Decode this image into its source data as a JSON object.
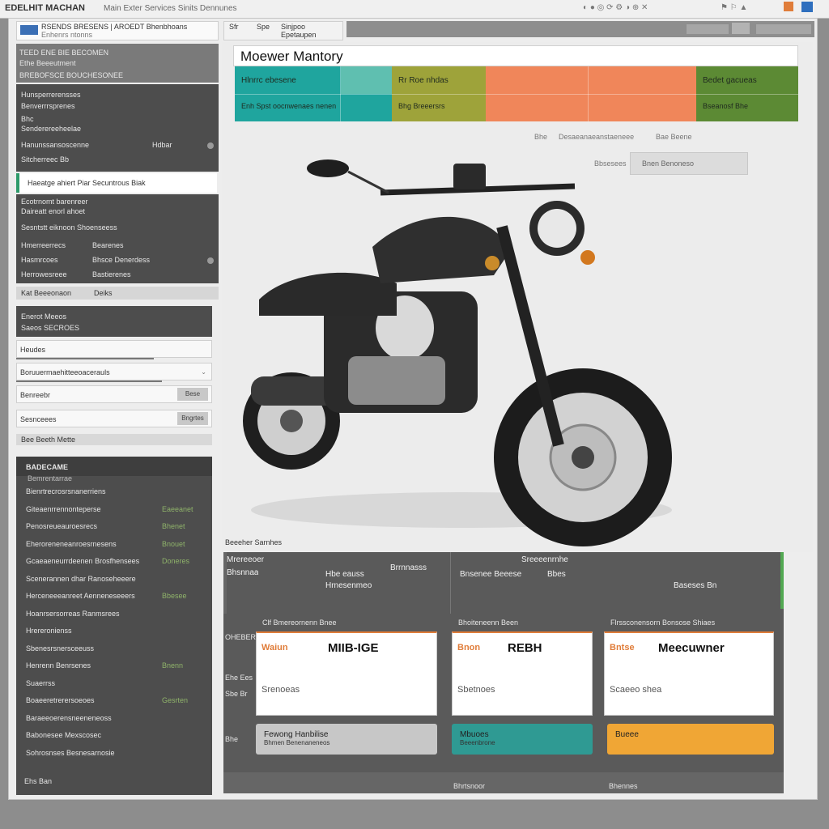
{
  "window": {
    "title": "EDELHIT MACHAN",
    "title_menu": "Main Exter Services Sinits Dennunes",
    "toolbar_tab_1": "Sfr",
    "toolbar_tab_2": "Spe",
    "toolbar_tab_3": "Sinjpoo",
    "toolbar_tab_4": "Epetaupen",
    "address": "RSENDS BRESENS | AROEDT Bhenbhoans",
    "address_2": "Enhenrs ntonns"
  },
  "sidebar": {
    "header_title": "TEED ENE BIE BECOMEN",
    "header_sub": "Ethe Beeeutment",
    "header_line2": "BREBOFSCE BOUCHESONEE",
    "group1": [
      {
        "label": "Hunsperrerensses",
        "value": ""
      },
      {
        "label": "Benverrrsprenes",
        "value": ""
      },
      {
        "label": "Bhc",
        "value": ""
      },
      {
        "label": "Senderereeheelae",
        "value": ""
      },
      {
        "label": "Hanunssansoscenne",
        "value": "Hdbar"
      },
      {
        "label": "Sitcherreec Bb",
        "value": ""
      }
    ],
    "selected_item": "Haeatge ahiert Piar Secuntrous Biak",
    "group2": [
      {
        "label": "Ecotrnomt barenreer",
        "value": ""
      },
      {
        "label": "Daireatt enorl ahoet",
        "value": ""
      },
      {
        "label": "Sesntstt eiknoon Shoenseess",
        "value": ""
      },
      {
        "label": "Hmerreerrecs",
        "value": "Bearenes"
      },
      {
        "label": "Hasmrcoes",
        "value": "Bhsce Denerdess"
      },
      {
        "label": "Herrowesreee",
        "value": "Bastierenes"
      }
    ],
    "divider_label": "Kat Beeeonaon",
    "divider_val": "Deiks",
    "form_title": "Enerot Meeos",
    "form_sub": "Saeos SECROES",
    "fields": [
      {
        "label": "Heudes",
        "button": ""
      },
      {
        "label": "Boruuermaehitteeoacerauls",
        "button": ""
      },
      {
        "label": "Benreebr",
        "button": "Bese"
      },
      {
        "label": "Sesnceees",
        "button": "Bngrtes"
      }
    ],
    "tiny_row": "Bee Beeth Mette",
    "list_title": "BADECAME",
    "list_subtitle": "Bemrentarrae",
    "list": [
      {
        "label": "Bienrtrecrosrsnanerriens",
        "value": ""
      },
      {
        "label": "Giteaenrrennonteperse",
        "value": "Eaeeanet"
      },
      {
        "label": "Penosreueauroesrecs",
        "value": "Bhenet"
      },
      {
        "label": "Eheroreneneanroesrnesens",
        "value": "Bnouet"
      },
      {
        "label": "Gcaeaeneurrdeenen Brosfhensees",
        "value": "Doneres"
      },
      {
        "label": "Scenerannen dhar Ranoseheeere",
        "value": ""
      },
      {
        "label": "Herceneeeanreet Aenneneseeers",
        "value": "Bbesee"
      },
      {
        "label": "Hoanrsersorreas Ranmsrees",
        "value": ""
      },
      {
        "label": "Hrereronienss",
        "value": ""
      },
      {
        "label": "Sbenesrsnersceeuss",
        "value": ""
      },
      {
        "label": "Henrenn Benrsenes",
        "value": "Bnenn"
      },
      {
        "label": "Suaerrss",
        "value": ""
      },
      {
        "label": "Boaeeretrerersoeoes",
        "value": "Gesrten"
      },
      {
        "label": "Baraeeoerensneeneneoss",
        "value": ""
      },
      {
        "label": "Babonesee Mexscosec",
        "value": ""
      },
      {
        "label": "Sohrosnses Besnesarnosie",
        "value": ""
      }
    ],
    "footer": "Ehs Ban"
  },
  "main": {
    "title": "Moewer Mantory",
    "color_bars": [
      {
        "top": "Hlnrrc ebesene",
        "bottom": "Enh Spst oocnwenaes nenen",
        "color": "#1fa59e"
      },
      {
        "top": "Rr Roe nhdas",
        "bottom": "Bhg Breeersrs",
        "color": "#9ea33a"
      },
      {
        "top": "",
        "bottom": "",
        "color": "#f0865a"
      },
      {
        "top": "Bedet gacueas",
        "bottom": "Bseanosf Bhe",
        "color": "#5c8a34"
      }
    ],
    "filter_label": "Bhe",
    "filter_value": "Desaeanaeanstaeneee",
    "filter_right": "Bae Beene",
    "search_label": "Bbsesees",
    "search_value": "Bnen Benoneso",
    "image_caption": "Beeeher Sarnhes",
    "spec_header": [
      {
        "label": "Mrereeoer",
        "value": "Bhsnnaa"
      },
      {
        "label": "Hbe eauss",
        "value": "Hrnesenmeo"
      },
      {
        "label": "Brrnnasss",
        "value": "Bnsenee Beeese"
      },
      {
        "label": "Sreeeenrnhe",
        "value": "Bbes"
      }
    ],
    "spec_extra": "Baseses Bn",
    "cards_section": [
      {
        "heading": "Clf Bmereornenn Bnee",
        "label": "Waiun",
        "value": "MIIB-IGE",
        "sub": "Srenoeas",
        "label_color": "#e07d3a",
        "pill_text": "Fewong Hanbilise",
        "pill_sub": "Bhmen Benenaneneos",
        "pill_color": "#c7c7c7"
      },
      {
        "heading": "Bhoiteneenn Been",
        "label": "Bnon",
        "value": "REBH",
        "sub": "Sbetnoes",
        "label_color": "#e07d3a",
        "pill_text": "Mbuoes",
        "pill_sub": "Beeenbrone",
        "pill_color": "#2f9a93"
      },
      {
        "heading": "Flrssconensorn Bonsose Shiaes",
        "label": "Bntse",
        "value": "Meecuwner",
        "sub": "Scaeeo shea",
        "label_color": "#e07d3a",
        "pill_text": "Bueee",
        "pill_sub": "",
        "pill_color": "#f0a635"
      }
    ],
    "row_labels": [
      "OHEBER",
      "Ehe Ees",
      "Sbe Br",
      "Bhe"
    ],
    "footer_tabs": [
      "Bhrtsnoor",
      "Bhennes"
    ]
  }
}
